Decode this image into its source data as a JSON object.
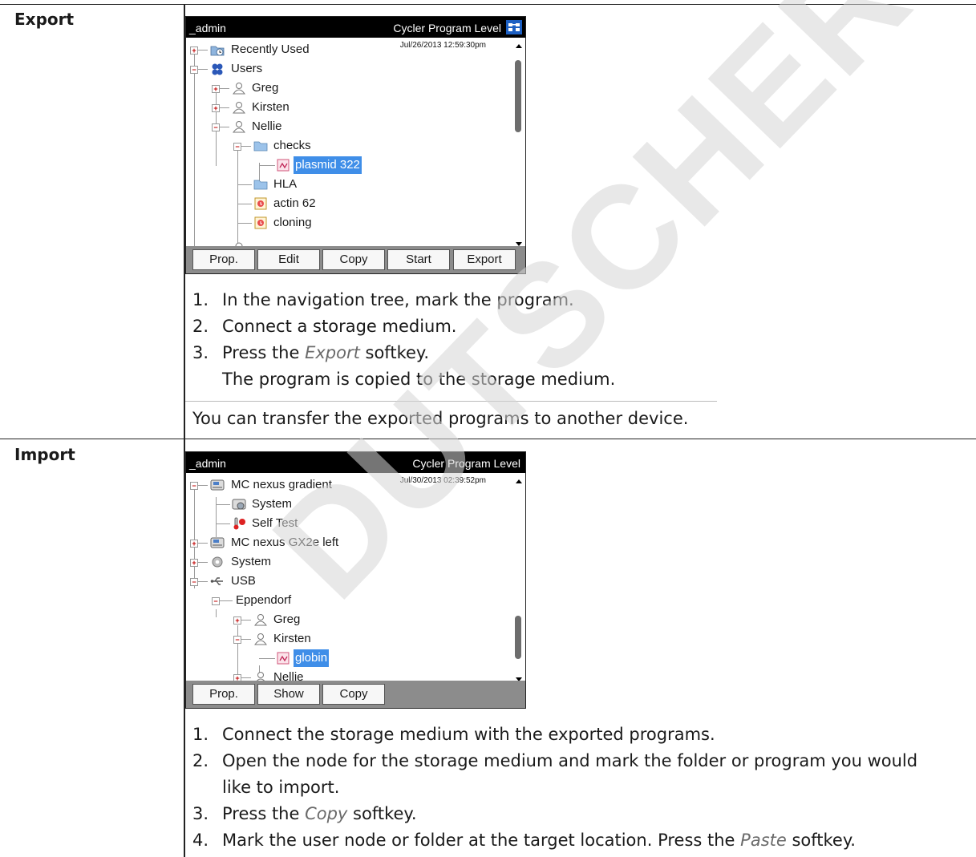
{
  "export_section": {
    "label": "Export",
    "screen": {
      "user": "_admin",
      "level": "Cycler Program Level",
      "datetime": "Jul/26/2013 12:59:30pm",
      "tree": [
        {
          "label": "Recently Used",
          "icon": "recently-used-icon"
        },
        {
          "label": "Users",
          "icon": "users-icon"
        },
        {
          "label": "Greg",
          "icon": "user-icon"
        },
        {
          "label": "Kirsten",
          "icon": "user-icon"
        },
        {
          "label": "Nellie",
          "icon": "user-icon"
        },
        {
          "label": "checks",
          "icon": "folder-icon"
        },
        {
          "label": "plasmid 322",
          "icon": "gradient-program-icon",
          "selected": true
        },
        {
          "label": "HLA",
          "icon": "folder-icon"
        },
        {
          "label": "actin 62",
          "icon": "program-icon"
        },
        {
          "label": "cloning",
          "icon": "program-icon"
        }
      ],
      "softkeys": [
        "Prop.",
        "Edit",
        "Copy",
        "Start",
        "Export"
      ]
    },
    "steps": [
      {
        "num": "1.",
        "text": "In the navigation tree, mark the program."
      },
      {
        "num": "2.",
        "text": "Connect a storage medium."
      },
      {
        "num": "3.",
        "before": "Press the ",
        "softkey": "Export",
        "after": " softkey."
      }
    ],
    "result": "The program is copied to the storage medium.",
    "note": "You can transfer the exported programs to another device."
  },
  "import_section": {
    "label": "Import",
    "screen": {
      "user": "_admin",
      "level": "Cycler Program Level",
      "datetime": "Jul/30/2013 02:39:52pm",
      "tree": [
        {
          "label": "MC nexus gradient",
          "icon": "cycler-icon"
        },
        {
          "label": "System",
          "icon": "system-settings-icon"
        },
        {
          "label": "Self Test",
          "icon": "self-test-icon"
        },
        {
          "label": "MC nexus GX2e left",
          "icon": "cycler-icon"
        },
        {
          "label": "System",
          "icon": "gear-icon"
        },
        {
          "label": "USB",
          "icon": "usb-icon"
        },
        {
          "label": "Eppendorf",
          "icon": ""
        },
        {
          "label": "Greg",
          "icon": "user-icon"
        },
        {
          "label": "Kirsten",
          "icon": "user-icon"
        },
        {
          "label": "globin",
          "icon": "gradient-program-icon",
          "selected": true
        },
        {
          "label": "Nellie",
          "icon": "user-icon"
        }
      ],
      "softkeys": [
        "Prop.",
        "Show",
        "Copy"
      ]
    },
    "steps": [
      {
        "num": "1.",
        "text": "Connect the storage medium with the exported programs."
      },
      {
        "num": "2.",
        "text": "Open the node for the storage medium and mark the folder or program you would",
        "text2": "like to import."
      },
      {
        "num": "3.",
        "before": "Press the ",
        "softkey": "Copy",
        "after": " softkey."
      },
      {
        "num": "4.",
        "before": "Mark the user node or folder at the target location. Press the ",
        "softkey": "Paste",
        "after": " softkey."
      }
    ]
  },
  "watermark": "DUTSCHER SA",
  "colors": {
    "selection": "#3f8ee8",
    "titlebar": "#000000",
    "softkey_bar": "#8c8c8c"
  }
}
